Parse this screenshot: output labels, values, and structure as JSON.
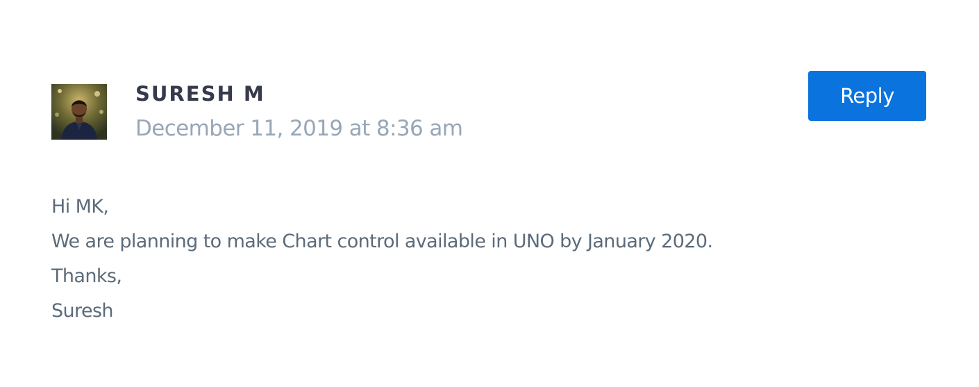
{
  "comment": {
    "author": "SURESH M",
    "date": "December 11, 2019 at 8:36 am",
    "reply_label": "Reply",
    "avatar_alt": "Suresh M avatar",
    "body_lines": [
      "Hi MK,",
      "We are planning to make Chart control available in UNO by January 2020.",
      "Thanks,",
      "Suresh"
    ]
  },
  "colors": {
    "accent": "#0a73de",
    "author": "#363a4a",
    "date": "#97a7b8",
    "body": "#5c6b7a"
  }
}
